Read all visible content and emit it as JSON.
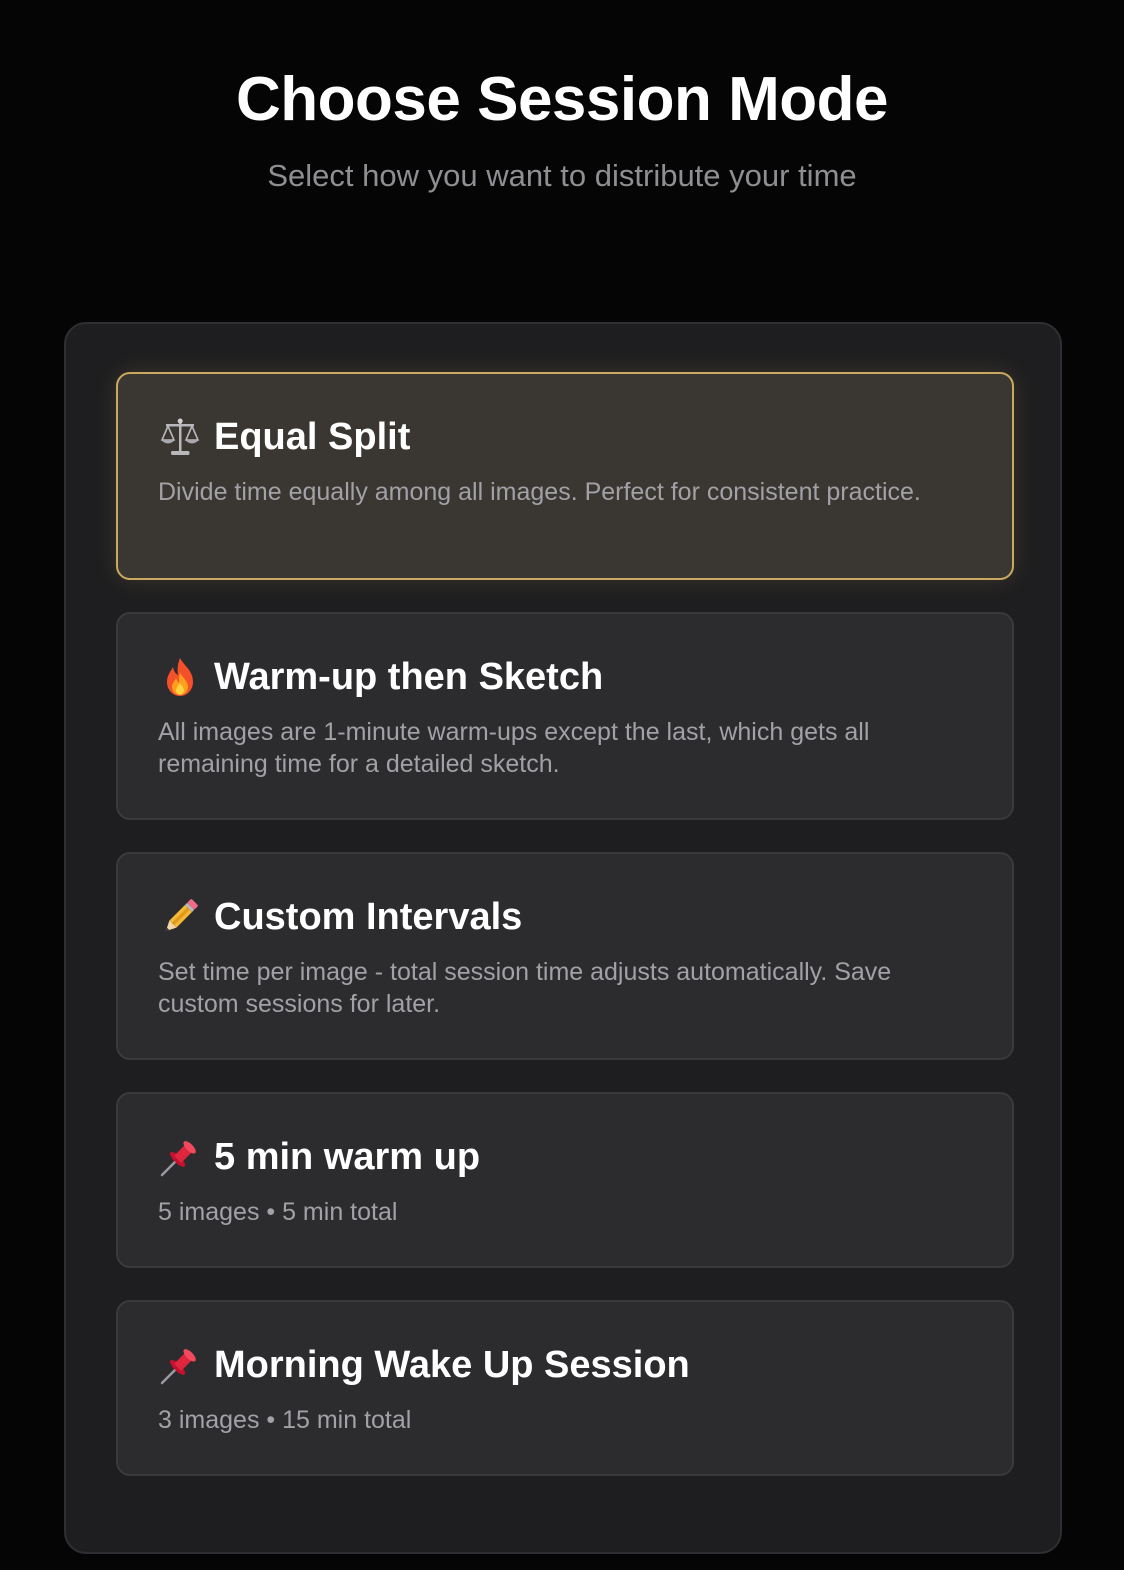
{
  "header": {
    "title": "Choose Session Mode",
    "subtitle": "Select how you want to distribute your time"
  },
  "modes": [
    {
      "icon": "scales-icon",
      "title": "Equal Split",
      "description": "Divide time equally among all images. Perfect for consistent practice.",
      "selected": true
    },
    {
      "icon": "fire-icon",
      "title": "Warm-up then Sketch",
      "description": "All images are 1-minute warm-ups except the last, which gets all remaining time for a detailed sketch.",
      "selected": false
    },
    {
      "icon": "pencil-icon",
      "title": "Custom Intervals",
      "description": "Set time per image - total session time adjusts automatically. Save custom sessions for later.",
      "selected": false
    },
    {
      "icon": "pushpin-icon",
      "title": "5 min warm up",
      "description": "5 images • 5 min total",
      "selected": false
    },
    {
      "icon": "pushpin-icon",
      "title": "Morning Wake Up Session",
      "description": "3 images • 15 min total",
      "selected": false
    }
  ],
  "colors": {
    "background": "#050505",
    "panel": "#1e1e20",
    "card": "#2c2c2f",
    "selected_card": "#3a3631",
    "selected_border": "#c9a961",
    "muted_text": "#a1a1a6"
  }
}
